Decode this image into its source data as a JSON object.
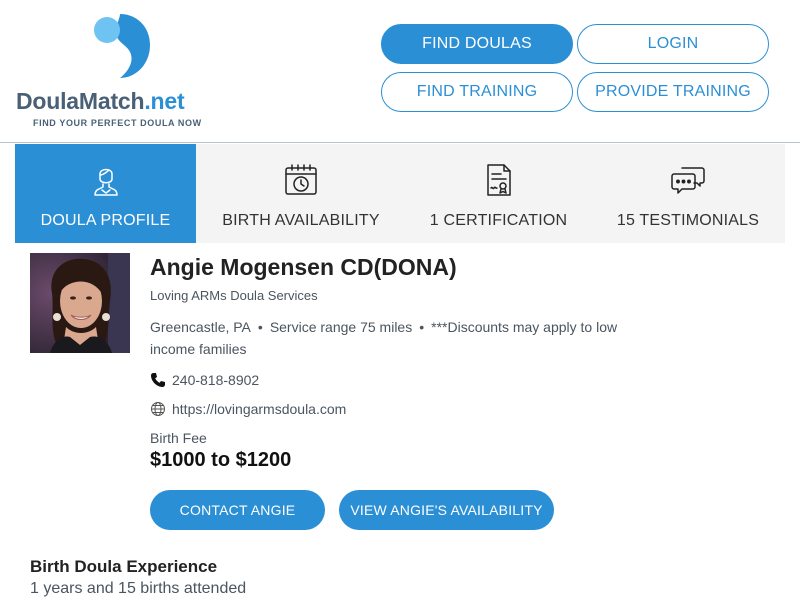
{
  "brand": {
    "name_main": "DoulaMatch",
    "name_suffix": ".net",
    "tagline": "FIND YOUR PERFECT DOULA NOW",
    "color": "#2b8fd6"
  },
  "nav": {
    "find_doulas": "FIND DOULAS",
    "login": "LOGIN",
    "find_training": "FIND TRAINING",
    "provide_training": "PROVIDE TRAINING"
  },
  "tabs": [
    {
      "label": "DOULA PROFILE",
      "icon": "person-icon",
      "active": true
    },
    {
      "label": "BIRTH AVAILABILITY",
      "icon": "calendar-clock-icon",
      "active": false
    },
    {
      "label": "1 CERTIFICATION",
      "icon": "certificate-icon",
      "active": false
    },
    {
      "label": "15 TESTIMONIALS",
      "icon": "chat-bubbles-icon",
      "active": false
    }
  ],
  "profile": {
    "name": "Angie Mogensen CD(DONA)",
    "organization": "Loving ARMs Doula Services",
    "city": "Greencastle, PA",
    "service_range": "Service range 75 miles",
    "note": "***Discounts may apply to low income families",
    "phone": "240-818-8902",
    "website": "https://lovingarmsdoula.com",
    "fee_label": "Birth Fee",
    "fee_value": "$1000 to $1200"
  },
  "actions": {
    "contact": "CONTACT ANGIE",
    "availability": "VIEW ANGIE'S AVAILABILITY"
  },
  "experience": {
    "title": "Birth Doula Experience",
    "text": "1 years and 15 births attended"
  }
}
